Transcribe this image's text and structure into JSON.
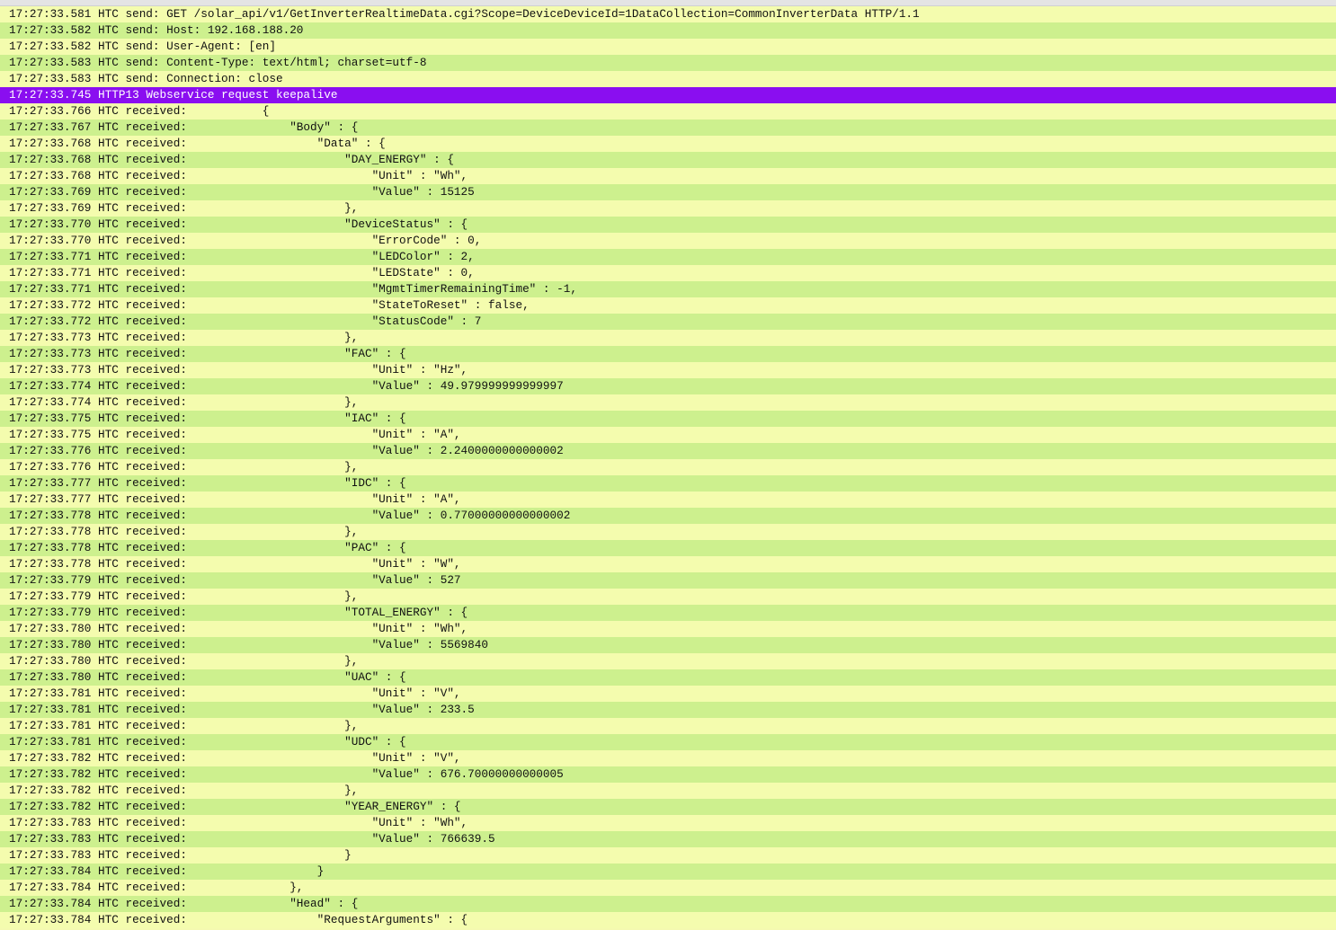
{
  "colors": {
    "row_even": "#f4fcae",
    "row_odd": "#cdf08e",
    "highlight": "#8a0ef0"
  },
  "lines": [
    {
      "time": "17:27:33.581",
      "source": "HTC",
      "text": "send: GET /solar_api/v1/GetInverterRealtimeData.cgi?Scope=DeviceDeviceId=1DataCollection=CommonInverterData HTTP/1.1"
    },
    {
      "time": "17:27:33.582",
      "source": "HTC",
      "text": "send: Host: 192.168.188.20"
    },
    {
      "time": "17:27:33.582",
      "source": "HTC",
      "text": "send: User-Agent: [en]"
    },
    {
      "time": "17:27:33.583",
      "source": "HTC",
      "text": "send: Content-Type: text/html; charset=utf-8"
    },
    {
      "time": "17:27:33.583",
      "source": "HTC",
      "text": "send: Connection: close"
    },
    {
      "time": "17:27:33.745",
      "source": "HTTP13",
      "text": "Webservice request keepalive",
      "highlight": true
    },
    {
      "time": "17:27:33.766",
      "source": "HTC",
      "text": "received:           {"
    },
    {
      "time": "17:27:33.767",
      "source": "HTC",
      "text": "received:               \"Body\" : {"
    },
    {
      "time": "17:27:33.768",
      "source": "HTC",
      "text": "received:                   \"Data\" : {"
    },
    {
      "time": "17:27:33.768",
      "source": "HTC",
      "text": "received:                       \"DAY_ENERGY\" : {"
    },
    {
      "time": "17:27:33.768",
      "source": "HTC",
      "text": "received:                           \"Unit\" : \"Wh\","
    },
    {
      "time": "17:27:33.769",
      "source": "HTC",
      "text": "received:                           \"Value\" : 15125"
    },
    {
      "time": "17:27:33.769",
      "source": "HTC",
      "text": "received:                       },"
    },
    {
      "time": "17:27:33.770",
      "source": "HTC",
      "text": "received:                       \"DeviceStatus\" : {"
    },
    {
      "time": "17:27:33.770",
      "source": "HTC",
      "text": "received:                           \"ErrorCode\" : 0,"
    },
    {
      "time": "17:27:33.771",
      "source": "HTC",
      "text": "received:                           \"LEDColor\" : 2,"
    },
    {
      "time": "17:27:33.771",
      "source": "HTC",
      "text": "received:                           \"LEDState\" : 0,"
    },
    {
      "time": "17:27:33.771",
      "source": "HTC",
      "text": "received:                           \"MgmtTimerRemainingTime\" : -1,"
    },
    {
      "time": "17:27:33.772",
      "source": "HTC",
      "text": "received:                           \"StateToReset\" : false,"
    },
    {
      "time": "17:27:33.772",
      "source": "HTC",
      "text": "received:                           \"StatusCode\" : 7"
    },
    {
      "time": "17:27:33.773",
      "source": "HTC",
      "text": "received:                       },"
    },
    {
      "time": "17:27:33.773",
      "source": "HTC",
      "text": "received:                       \"FAC\" : {"
    },
    {
      "time": "17:27:33.773",
      "source": "HTC",
      "text": "received:                           \"Unit\" : \"Hz\","
    },
    {
      "time": "17:27:33.774",
      "source": "HTC",
      "text": "received:                           \"Value\" : 49.979999999999997"
    },
    {
      "time": "17:27:33.774",
      "source": "HTC",
      "text": "received:                       },"
    },
    {
      "time": "17:27:33.775",
      "source": "HTC",
      "text": "received:                       \"IAC\" : {"
    },
    {
      "time": "17:27:33.775",
      "source": "HTC",
      "text": "received:                           \"Unit\" : \"A\","
    },
    {
      "time": "17:27:33.776",
      "source": "HTC",
      "text": "received:                           \"Value\" : 2.2400000000000002"
    },
    {
      "time": "17:27:33.776",
      "source": "HTC",
      "text": "received:                       },"
    },
    {
      "time": "17:27:33.777",
      "source": "HTC",
      "text": "received:                       \"IDC\" : {"
    },
    {
      "time": "17:27:33.777",
      "source": "HTC",
      "text": "received:                           \"Unit\" : \"A\","
    },
    {
      "time": "17:27:33.778",
      "source": "HTC",
      "text": "received:                           \"Value\" : 0.77000000000000002"
    },
    {
      "time": "17:27:33.778",
      "source": "HTC",
      "text": "received:                       },"
    },
    {
      "time": "17:27:33.778",
      "source": "HTC",
      "text": "received:                       \"PAC\" : {"
    },
    {
      "time": "17:27:33.778",
      "source": "HTC",
      "text": "received:                           \"Unit\" : \"W\","
    },
    {
      "time": "17:27:33.779",
      "source": "HTC",
      "text": "received:                           \"Value\" : 527"
    },
    {
      "time": "17:27:33.779",
      "source": "HTC",
      "text": "received:                       },"
    },
    {
      "time": "17:27:33.779",
      "source": "HTC",
      "text": "received:                       \"TOTAL_ENERGY\" : {"
    },
    {
      "time": "17:27:33.780",
      "source": "HTC",
      "text": "received:                           \"Unit\" : \"Wh\","
    },
    {
      "time": "17:27:33.780",
      "source": "HTC",
      "text": "received:                           \"Value\" : 5569840"
    },
    {
      "time": "17:27:33.780",
      "source": "HTC",
      "text": "received:                       },"
    },
    {
      "time": "17:27:33.780",
      "source": "HTC",
      "text": "received:                       \"UAC\" : {"
    },
    {
      "time": "17:27:33.781",
      "source": "HTC",
      "text": "received:                           \"Unit\" : \"V\","
    },
    {
      "time": "17:27:33.781",
      "source": "HTC",
      "text": "received:                           \"Value\" : 233.5"
    },
    {
      "time": "17:27:33.781",
      "source": "HTC",
      "text": "received:                       },"
    },
    {
      "time": "17:27:33.781",
      "source": "HTC",
      "text": "received:                       \"UDC\" : {"
    },
    {
      "time": "17:27:33.782",
      "source": "HTC",
      "text": "received:                           \"Unit\" : \"V\","
    },
    {
      "time": "17:27:33.782",
      "source": "HTC",
      "text": "received:                           \"Value\" : 676.70000000000005"
    },
    {
      "time": "17:27:33.782",
      "source": "HTC",
      "text": "received:                       },"
    },
    {
      "time": "17:27:33.782",
      "source": "HTC",
      "text": "received:                       \"YEAR_ENERGY\" : {"
    },
    {
      "time": "17:27:33.783",
      "source": "HTC",
      "text": "received:                           \"Unit\" : \"Wh\","
    },
    {
      "time": "17:27:33.783",
      "source": "HTC",
      "text": "received:                           \"Value\" : 766639.5"
    },
    {
      "time": "17:27:33.783",
      "source": "HTC",
      "text": "received:                       }"
    },
    {
      "time": "17:27:33.784",
      "source": "HTC",
      "text": "received:                   }"
    },
    {
      "time": "17:27:33.784",
      "source": "HTC",
      "text": "received:               },"
    },
    {
      "time": "17:27:33.784",
      "source": "HTC",
      "text": "received:               \"Head\" : {"
    },
    {
      "time": "17:27:33.784",
      "source": "HTC",
      "text": "received:                   \"RequestArguments\" : {"
    }
  ]
}
